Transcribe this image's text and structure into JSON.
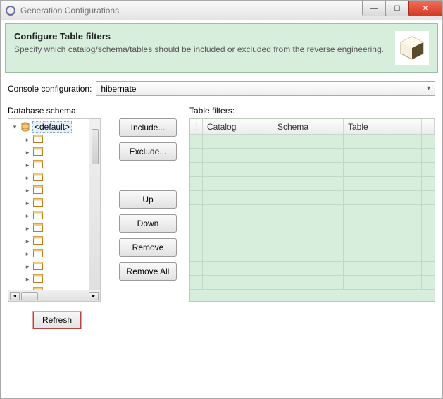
{
  "window": {
    "title": "Generation Configurations"
  },
  "header": {
    "title": "Configure Table filters",
    "subtitle": "Specify which catalog/schema/tables should be included or excluded from the reverse engineering."
  },
  "console_config": {
    "label": "Console configuration:",
    "value": "hibernate"
  },
  "schema": {
    "label": "Database schema:",
    "root_label": "<default>",
    "refresh_label": "Refresh"
  },
  "buttons": {
    "include": "Include...",
    "exclude": "Exclude...",
    "up": "Up",
    "down": "Down",
    "remove": "Remove",
    "remove_all": "Remove All"
  },
  "filters": {
    "label": "Table filters:",
    "columns": {
      "excl": "!",
      "catalog": "Catalog",
      "schema": "Schema",
      "table": "Table"
    }
  },
  "window_controls": {
    "min": "—",
    "max": "☐",
    "close": "✕"
  }
}
